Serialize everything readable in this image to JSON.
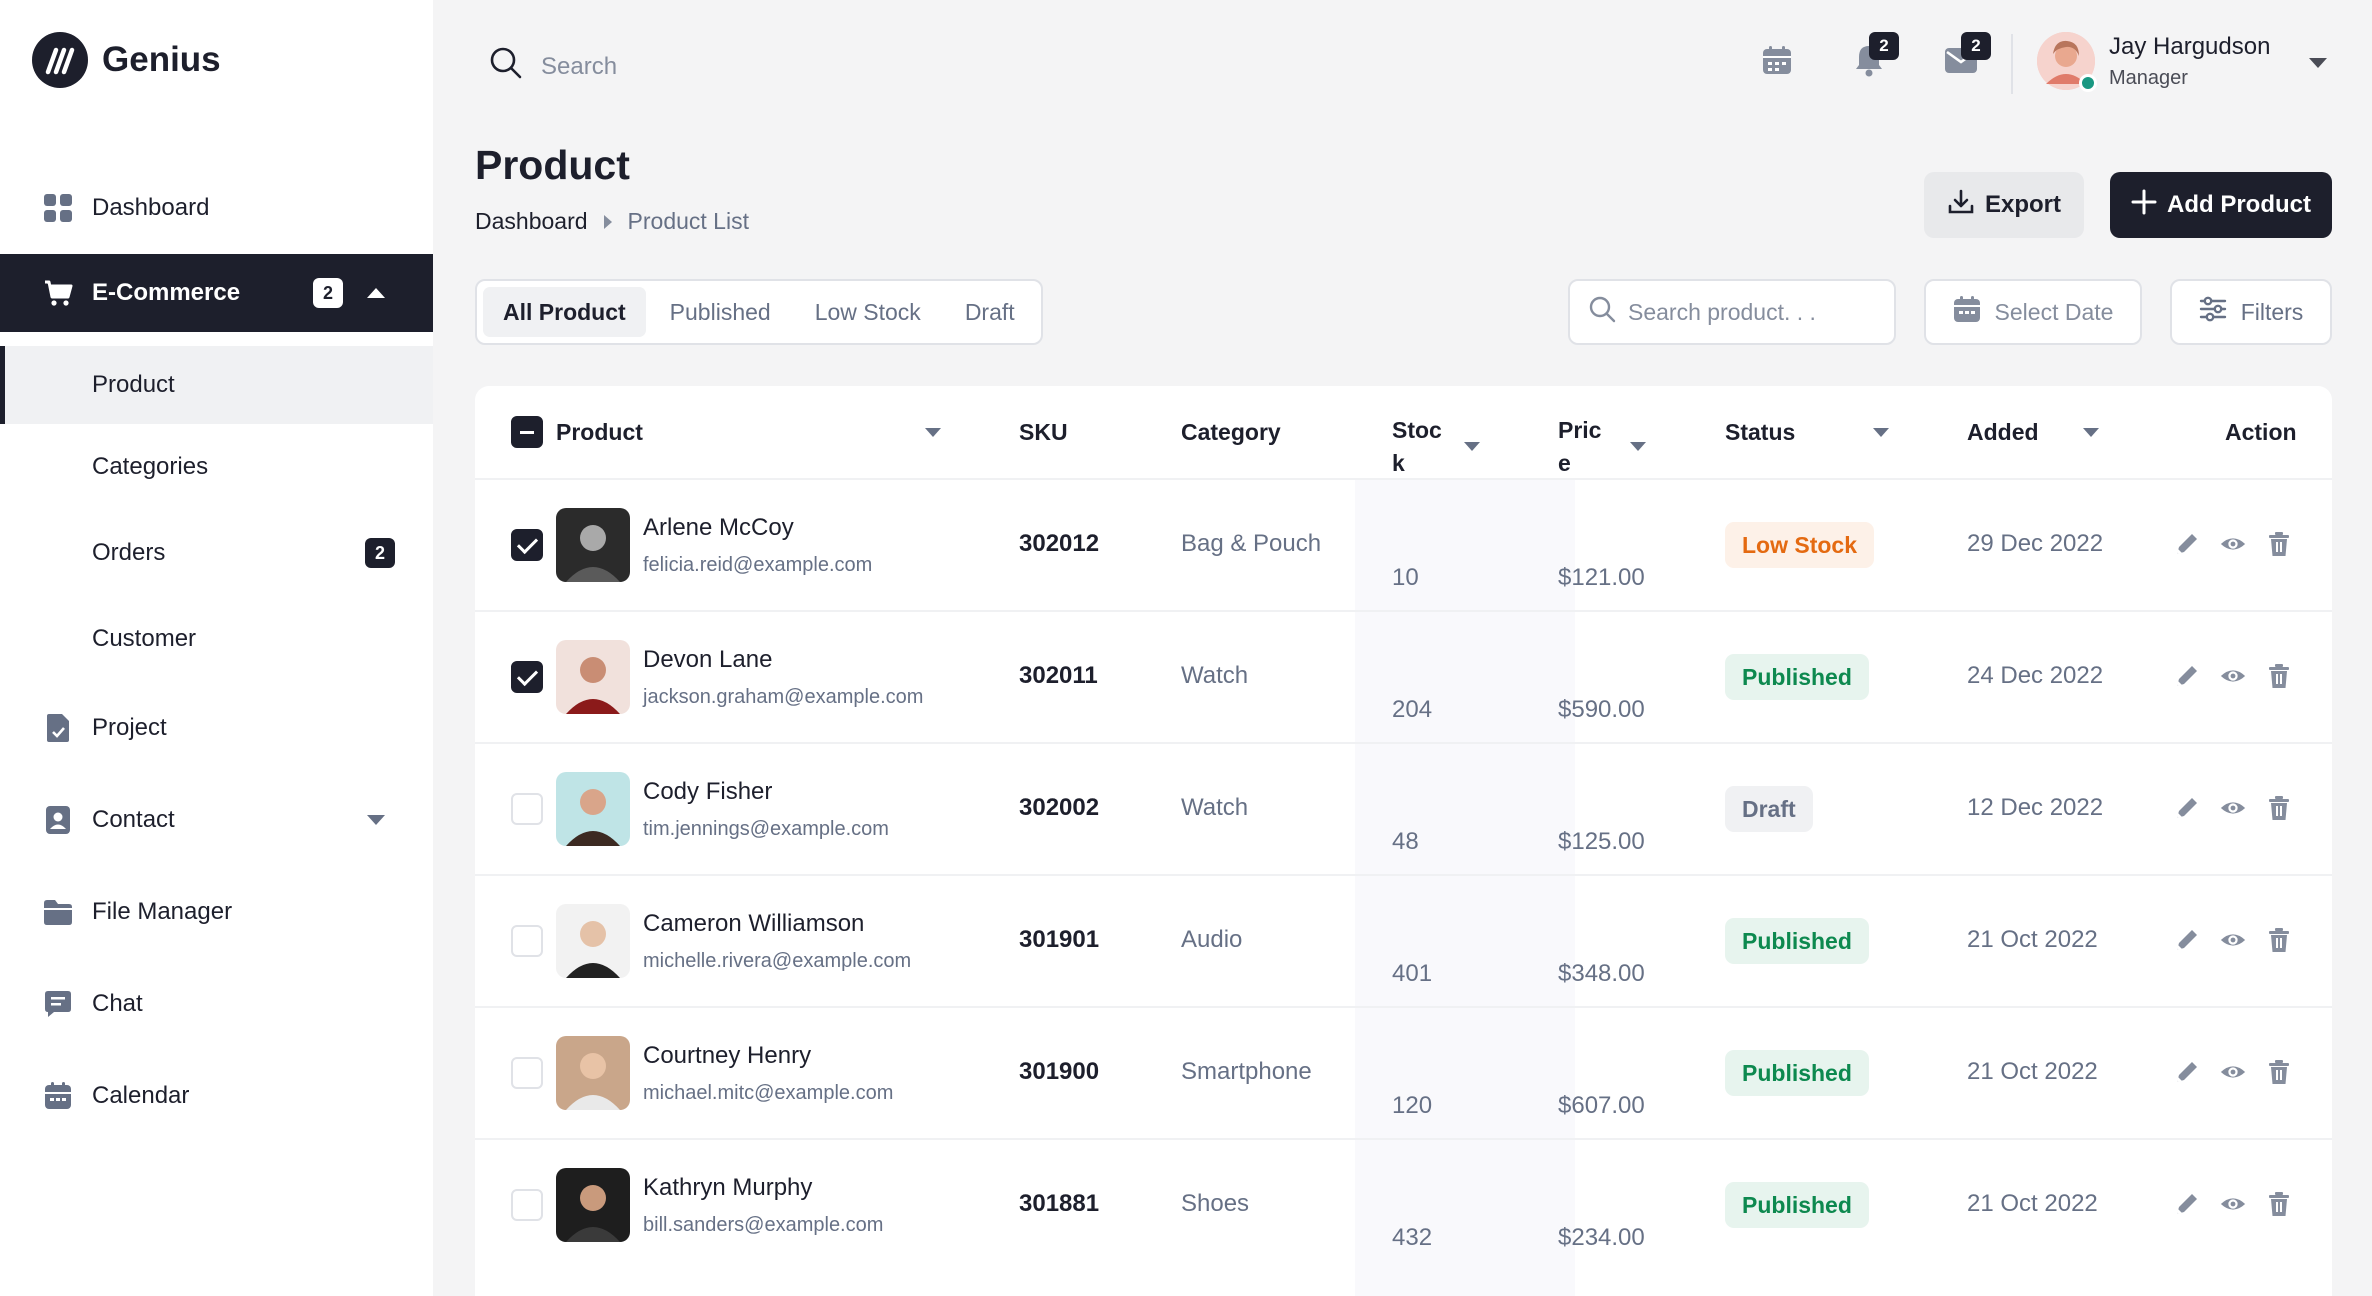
{
  "brand": {
    "name": "Genius"
  },
  "sidebar": {
    "items": [
      {
        "label": "Dashboard",
        "icon": "dashboard-grid-icon"
      },
      {
        "label": "E-Commerce",
        "icon": "cart-icon",
        "badge": "2",
        "expanded": true,
        "children": [
          {
            "label": "Product",
            "active": true
          },
          {
            "label": "Categories"
          },
          {
            "label": "Orders",
            "badge": "2"
          },
          {
            "label": "Customer"
          }
        ]
      },
      {
        "label": "Project",
        "icon": "project-document-icon"
      },
      {
        "label": "Contact",
        "icon": "contact-card-icon"
      },
      {
        "label": "File Manager",
        "icon": "folder-icon"
      },
      {
        "label": "Chat",
        "icon": "chat-icon"
      },
      {
        "label": "Calendar",
        "icon": "calendar-icon"
      }
    ]
  },
  "topbar": {
    "search_placeholder": "Search",
    "notifications_count": "2",
    "messages_count": "2",
    "user": {
      "name": "Jay Hargudson",
      "role": "Manager"
    }
  },
  "page": {
    "title": "Product",
    "breadcrumb": [
      "Dashboard",
      "Product List"
    ],
    "export_label": "Export",
    "add_label": "Add Product"
  },
  "filters": {
    "tabs": [
      "All Product",
      "Published",
      "Low Stock",
      "Draft"
    ],
    "active_tab": "All Product",
    "search_placeholder": "Search product. . .",
    "date_label": "Select Date",
    "filters_label": "Filters"
  },
  "table": {
    "columns": {
      "product": "Product",
      "sku": "SKU",
      "category": "Category",
      "stock_a": "Stoc",
      "stock_b": "k",
      "price_a": "Pric",
      "price_b": "e",
      "status": "Status",
      "added": "Added",
      "action": "Action"
    },
    "rows": [
      {
        "name": "Arlene McCoy",
        "email": "felicia.reid@example.com",
        "sku": "302012",
        "category": "Bag & Pouch",
        "stock": "10",
        "price": "$121.00",
        "status": "Low Stock",
        "added": "29 Dec 2022",
        "checked": true
      },
      {
        "name": "Devon Lane",
        "email": "jackson.graham@example.com",
        "sku": "302011",
        "category": "Watch",
        "stock": "204",
        "price": "$590.00",
        "status": "Published",
        "added": "24 Dec 2022",
        "checked": true
      },
      {
        "name": "Cody Fisher",
        "email": "tim.jennings@example.com",
        "sku": "302002",
        "category": "Watch",
        "stock": "48",
        "price": "$125.00",
        "status": "Draft",
        "added": "12 Dec 2022",
        "checked": false
      },
      {
        "name": "Cameron Williamson",
        "email": "michelle.rivera@example.com",
        "sku": "301901",
        "category": "Audio",
        "stock": "401",
        "price": "$348.00",
        "status": "Published",
        "added": "21 Oct 2022",
        "checked": false
      },
      {
        "name": "Courtney Henry",
        "email": "michael.mitc@example.com",
        "sku": "301900",
        "category": "Smartphone",
        "stock": "120",
        "price": "$607.00",
        "status": "Published",
        "added": "21 Oct 2022",
        "checked": false
      },
      {
        "name": "Kathryn Murphy",
        "email": "bill.sanders@example.com",
        "sku": "301881",
        "category": "Shoes",
        "stock": "432",
        "price": "$234.00",
        "status": "Published",
        "added": "21 Oct 2022",
        "checked": false
      }
    ]
  },
  "colors": {
    "primary": "#1d1f2c",
    "low_stock": "#e46a11",
    "published": "#0d894f",
    "draft": "#667085",
    "online": "#1a9882"
  }
}
